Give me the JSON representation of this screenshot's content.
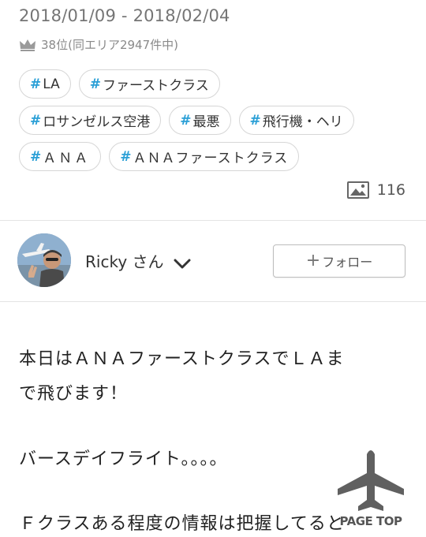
{
  "post_meta": {
    "date_range": "2018/01/09 - 2018/02/04",
    "rank_text": "38位(同エリア2947件中)"
  },
  "tags": [
    [
      "LA",
      "ファーストクラス"
    ],
    [
      "ロサンゼルス空港",
      "最悪",
      "飛行機・ヘリ"
    ],
    [
      "ＡＮＡ",
      "ＡＮＡファーストクラス"
    ]
  ],
  "tag_hash": "#",
  "photo_count": "116",
  "author": {
    "name": "Ricky さん",
    "follow_label": "フォロー",
    "follow_plus": "+"
  },
  "content": {
    "line1": "本日はＡＮＡファーストクラスでＬＡま",
    "line2": "で飛びます！",
    "line3": "バースデイフライト。。。。",
    "line4": "Ｆクラスある程度の情報は把握してると"
  },
  "page_top_label": "PAGE TOP",
  "icons": {
    "rank": "crown-icon",
    "photos": "image-icon",
    "author_menu": "chevron-down-icon",
    "page_top": "airplane-icon"
  },
  "colors": {
    "hash": "#2a9fd6",
    "text": "#333333",
    "muted": "#8a8a8a"
  }
}
